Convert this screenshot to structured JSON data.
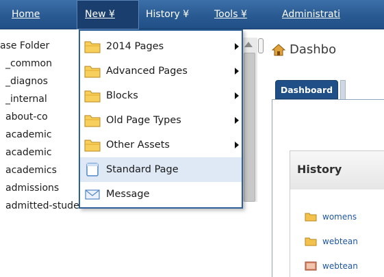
{
  "nav": {
    "home": "Home",
    "new": "New ¥",
    "history": "History ¥",
    "tools": "Tools ¥",
    "admin": "Administrati"
  },
  "tree": {
    "items": [
      "ase Folder",
      "_common",
      "_diagnos",
      "_internal",
      "about-co",
      "academic",
      "academic",
      "academics",
      "admissions",
      "admitted-students"
    ]
  },
  "menu": {
    "items": [
      {
        "label": "2014 Pages",
        "icon": "folder-icon",
        "submenu": true
      },
      {
        "label": "Advanced Pages",
        "icon": "folder-icon",
        "submenu": true
      },
      {
        "label": "Blocks",
        "icon": "folder-icon",
        "submenu": true
      },
      {
        "label": "Old Page Types",
        "icon": "folder-icon",
        "submenu": true
      },
      {
        "label": "Other Assets",
        "icon": "folder-icon",
        "submenu": true
      },
      {
        "label": "Standard Page",
        "icon": "page-icon",
        "submenu": false
      },
      {
        "label": "Message",
        "icon": "envelope-icon",
        "submenu": false
      }
    ]
  },
  "main": {
    "title": "Dashbo",
    "tab": "Dashboard",
    "history_title": "History",
    "history_items": [
      "womens",
      "webtean",
      "webtean"
    ]
  },
  "colors": {
    "nav_bg": "#2a5a92",
    "menu_border": "#2c5f97",
    "folder": "#f2c14e",
    "link": "#1e56a0"
  }
}
